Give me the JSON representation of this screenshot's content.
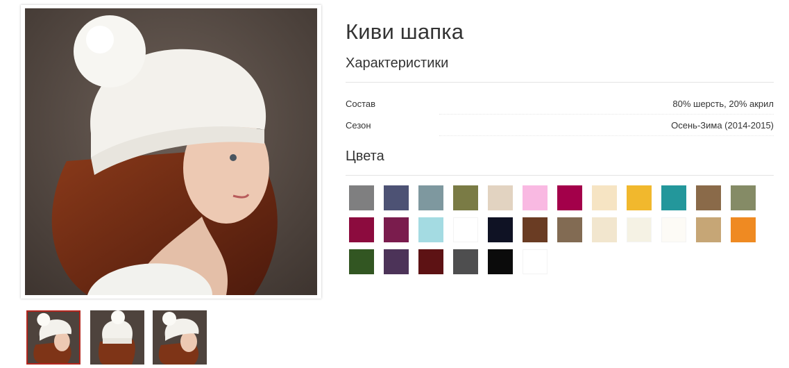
{
  "product": {
    "title": "Киви шапка",
    "characteristics_heading": "Характеристики",
    "characteristics": [
      {
        "label": "Состав",
        "value": "80% шерсть, 20% акрил"
      },
      {
        "label": "Сезон",
        "value": "Осень-Зима (2014-2015)"
      }
    ],
    "colors_heading": "Цвета"
  },
  "gallery": {
    "main_image": "model-in-white-pompom-hat",
    "thumbnails": [
      {
        "name": "thumb-side-view",
        "active": true
      },
      {
        "name": "thumb-back-view",
        "active": false
      },
      {
        "name": "thumb-side-view-2",
        "active": false
      }
    ],
    "active_border_color": "#b3261e"
  },
  "colors": [
    [
      "#7f7f80",
      "#4d5274",
      "#7e989f",
      "#7a7b45",
      "#e2d3c1",
      "#f9b9e2",
      "#a3004a",
      "#f6e4c3",
      "#f1b82d",
      "#23979b",
      "#8a6a49",
      "#858b66"
    ],
    [
      "#8c0b3e",
      "#7a1c4d",
      "#a4dbe2",
      "#ffffff",
      "#0f1224",
      "#6a3c23",
      "#826b53",
      "#f2e6ce",
      "#f5f2e4",
      "#fdfbf6",
      "#c6a676",
      "#ef8a22"
    ],
    [
      "#325622",
      "#4c3358",
      "#5d1214",
      "#4e4e4f",
      "#0b0b0b",
      "#ffffff"
    ]
  ]
}
